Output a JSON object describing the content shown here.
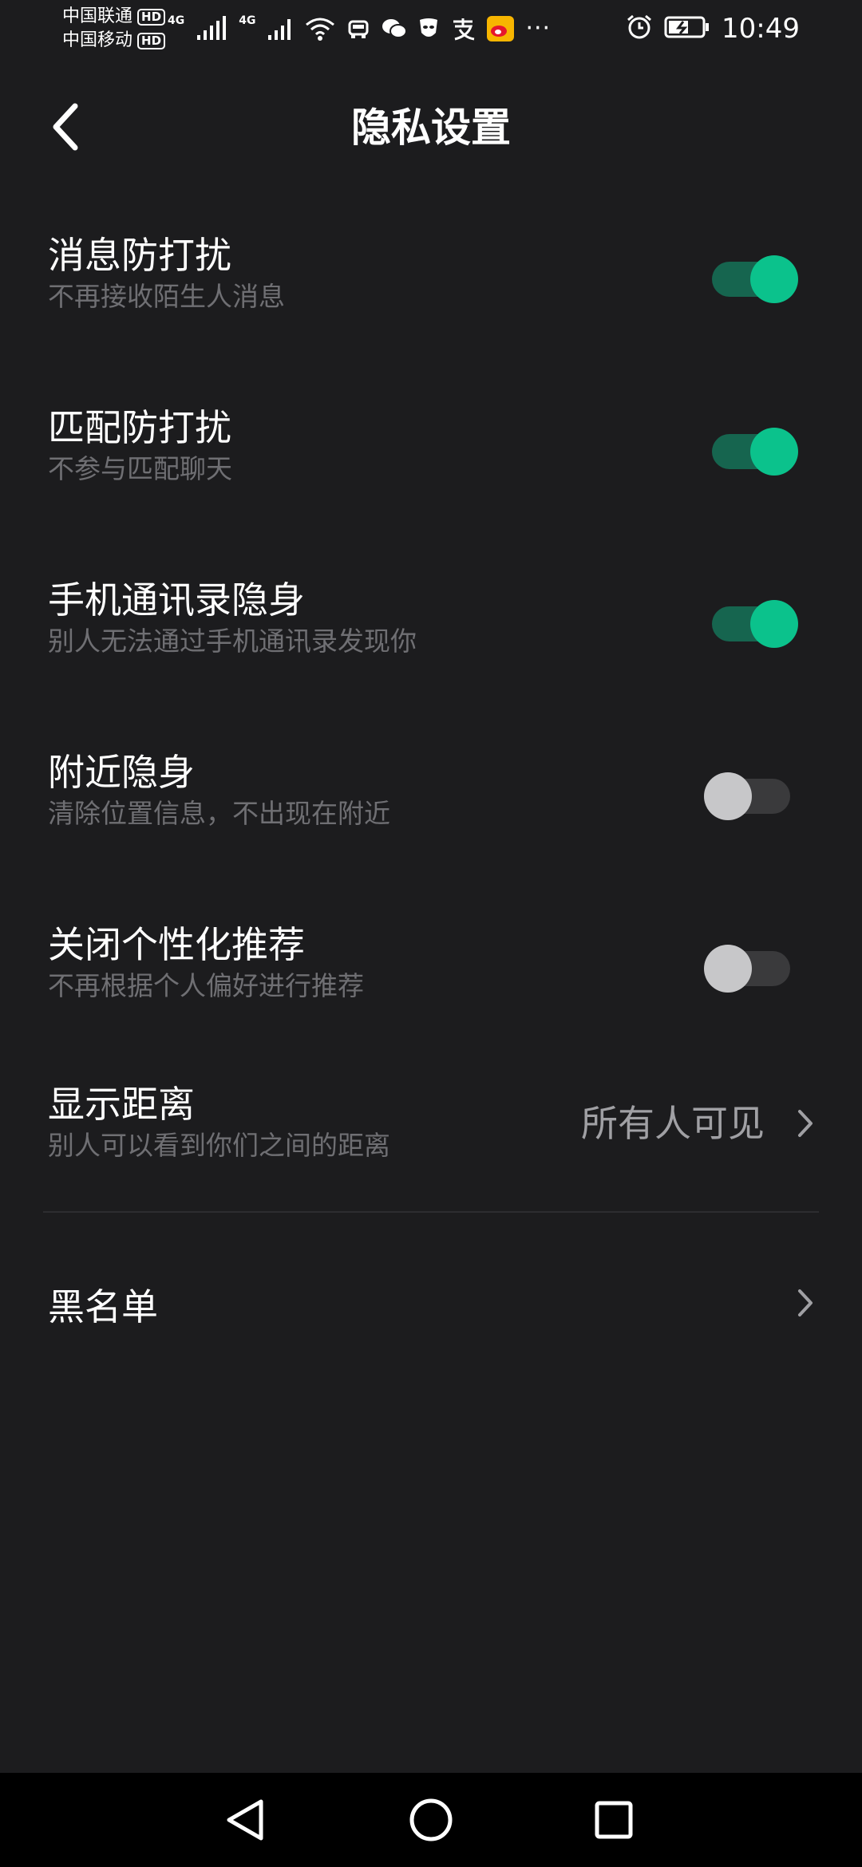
{
  "status_bar": {
    "carrier_1": "中国联通",
    "carrier_2": "中国移动",
    "hd_badge": "HD",
    "net_label_1": "4G",
    "net_label_2": "4G",
    "more": "···",
    "time": "10:49"
  },
  "header": {
    "title": "隐私设置"
  },
  "settings": [
    {
      "title": "消息防打扰",
      "desc": "不再接收陌生人消息",
      "enabled": true
    },
    {
      "title": "匹配防打扰",
      "desc": "不参与匹配聊天",
      "enabled": true
    },
    {
      "title": "手机通讯录隐身",
      "desc": "别人无法通过手机通讯录发现你",
      "enabled": true
    },
    {
      "title": "附近隐身",
      "desc": "清除位置信息，不出现在附近",
      "enabled": false
    },
    {
      "title": "关闭个性化推荐",
      "desc": "不再根据个人偏好进行推荐",
      "enabled": false
    }
  ],
  "distance": {
    "title": "显示距离",
    "desc": "别人可以看到你们之间的距离",
    "value": "所有人可见"
  },
  "blacklist": {
    "label": "黑名单"
  },
  "colors": {
    "background": "#1c1c1e",
    "toggle_on_knob": "#0bc28c",
    "toggle_on_track": "#16654f",
    "toggle_off_knob": "#c7c7c9",
    "toggle_off_track": "#3a3a3c",
    "secondary_text": "#6f6f73"
  }
}
